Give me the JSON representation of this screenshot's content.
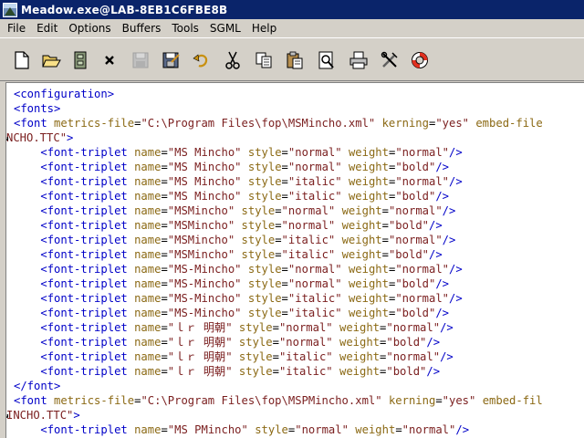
{
  "window": {
    "title": "Meadow.exe@LAB-8EB1C6FBE8B"
  },
  "menu": [
    "File",
    "Edit",
    "Options",
    "Buffers",
    "Tools",
    "SGML",
    "Help"
  ],
  "toolbar": [
    {
      "name": "new-file-icon"
    },
    {
      "name": "open-folder-icon"
    },
    {
      "name": "file-cabinet-icon"
    },
    {
      "name": "close-icon"
    },
    {
      "name": "save-disabled-icon"
    },
    {
      "name": "save-as-icon"
    },
    {
      "name": "undo-icon"
    },
    {
      "name": "cut-icon"
    },
    {
      "name": "copy-icon"
    },
    {
      "name": "paste-icon"
    },
    {
      "name": "search-icon"
    },
    {
      "name": "print-icon"
    },
    {
      "name": "tools-icon"
    },
    {
      "name": "help-lifebuoy-icon"
    }
  ],
  "editor": {
    "lines": [
      [
        {
          "t": "tag",
          "s": "<configuration>"
        }
      ],
      [
        {
          "t": "tag",
          "s": "<fonts>"
        }
      ],
      [
        {
          "t": "tag",
          "s": "<font "
        },
        {
          "t": "attr",
          "s": "metrics-file"
        },
        {
          "t": "plain",
          "s": "="
        },
        {
          "t": "val",
          "s": "\"C:\\Program Files\\fop\\MSMincho.xml\""
        },
        {
          "t": "plain",
          "s": " "
        },
        {
          "t": "attr",
          "s": "kerning"
        },
        {
          "t": "plain",
          "s": "="
        },
        {
          "t": "val",
          "s": "\"yes\""
        },
        {
          "t": "plain",
          "s": " "
        },
        {
          "t": "attr",
          "s": "embed-file"
        }
      ],
      [
        {
          "t": "cont",
          "s": "NCHO.TTC\""
        },
        {
          "t": "tag",
          "s": ">"
        }
      ],
      [
        {
          "t": "plain",
          "s": "    "
        },
        {
          "t": "tag",
          "s": "<font-triplet "
        },
        {
          "t": "attr",
          "s": "name"
        },
        {
          "t": "plain",
          "s": "="
        },
        {
          "t": "val",
          "s": "\"MS Mincho\""
        },
        {
          "t": "plain",
          "s": " "
        },
        {
          "t": "attr",
          "s": "style"
        },
        {
          "t": "plain",
          "s": "="
        },
        {
          "t": "val",
          "s": "\"normal\""
        },
        {
          "t": "plain",
          "s": " "
        },
        {
          "t": "attr",
          "s": "weight"
        },
        {
          "t": "plain",
          "s": "="
        },
        {
          "t": "val",
          "s": "\"normal\""
        },
        {
          "t": "tag",
          "s": "/>"
        }
      ],
      [
        {
          "t": "plain",
          "s": "    "
        },
        {
          "t": "tag",
          "s": "<font-triplet "
        },
        {
          "t": "attr",
          "s": "name"
        },
        {
          "t": "plain",
          "s": "="
        },
        {
          "t": "val",
          "s": "\"MS Mincho\""
        },
        {
          "t": "plain",
          "s": " "
        },
        {
          "t": "attr",
          "s": "style"
        },
        {
          "t": "plain",
          "s": "="
        },
        {
          "t": "val",
          "s": "\"normal\""
        },
        {
          "t": "plain",
          "s": " "
        },
        {
          "t": "attr",
          "s": "weight"
        },
        {
          "t": "plain",
          "s": "="
        },
        {
          "t": "val",
          "s": "\"bold\""
        },
        {
          "t": "tag",
          "s": "/>"
        }
      ],
      [
        {
          "t": "plain",
          "s": "    "
        },
        {
          "t": "tag",
          "s": "<font-triplet "
        },
        {
          "t": "attr",
          "s": "name"
        },
        {
          "t": "plain",
          "s": "="
        },
        {
          "t": "val",
          "s": "\"MS Mincho\""
        },
        {
          "t": "plain",
          "s": " "
        },
        {
          "t": "attr",
          "s": "style"
        },
        {
          "t": "plain",
          "s": "="
        },
        {
          "t": "val",
          "s": "\"italic\""
        },
        {
          "t": "plain",
          "s": " "
        },
        {
          "t": "attr",
          "s": "weight"
        },
        {
          "t": "plain",
          "s": "="
        },
        {
          "t": "val",
          "s": "\"normal\""
        },
        {
          "t": "tag",
          "s": "/>"
        }
      ],
      [
        {
          "t": "plain",
          "s": "    "
        },
        {
          "t": "tag",
          "s": "<font-triplet "
        },
        {
          "t": "attr",
          "s": "name"
        },
        {
          "t": "plain",
          "s": "="
        },
        {
          "t": "val",
          "s": "\"MS Mincho\""
        },
        {
          "t": "plain",
          "s": " "
        },
        {
          "t": "attr",
          "s": "style"
        },
        {
          "t": "plain",
          "s": "="
        },
        {
          "t": "val",
          "s": "\"italic\""
        },
        {
          "t": "plain",
          "s": " "
        },
        {
          "t": "attr",
          "s": "weight"
        },
        {
          "t": "plain",
          "s": "="
        },
        {
          "t": "val",
          "s": "\"bold\""
        },
        {
          "t": "tag",
          "s": "/>"
        }
      ],
      [
        {
          "t": "plain",
          "s": "    "
        },
        {
          "t": "tag",
          "s": "<font-triplet "
        },
        {
          "t": "attr",
          "s": "name"
        },
        {
          "t": "plain",
          "s": "="
        },
        {
          "t": "val",
          "s": "\"MSMincho\""
        },
        {
          "t": "plain",
          "s": " "
        },
        {
          "t": "attr",
          "s": "style"
        },
        {
          "t": "plain",
          "s": "="
        },
        {
          "t": "val",
          "s": "\"normal\""
        },
        {
          "t": "plain",
          "s": " "
        },
        {
          "t": "attr",
          "s": "weight"
        },
        {
          "t": "plain",
          "s": "="
        },
        {
          "t": "val",
          "s": "\"normal\""
        },
        {
          "t": "tag",
          "s": "/>"
        }
      ],
      [
        {
          "t": "plain",
          "s": "    "
        },
        {
          "t": "tag",
          "s": "<font-triplet "
        },
        {
          "t": "attr",
          "s": "name"
        },
        {
          "t": "plain",
          "s": "="
        },
        {
          "t": "val",
          "s": "\"MSMincho\""
        },
        {
          "t": "plain",
          "s": " "
        },
        {
          "t": "attr",
          "s": "style"
        },
        {
          "t": "plain",
          "s": "="
        },
        {
          "t": "val",
          "s": "\"normal\""
        },
        {
          "t": "plain",
          "s": " "
        },
        {
          "t": "attr",
          "s": "weight"
        },
        {
          "t": "plain",
          "s": "="
        },
        {
          "t": "val",
          "s": "\"bold\""
        },
        {
          "t": "tag",
          "s": "/>"
        }
      ],
      [
        {
          "t": "plain",
          "s": "    "
        },
        {
          "t": "tag",
          "s": "<font-triplet "
        },
        {
          "t": "attr",
          "s": "name"
        },
        {
          "t": "plain",
          "s": "="
        },
        {
          "t": "val",
          "s": "\"MSMincho\""
        },
        {
          "t": "plain",
          "s": " "
        },
        {
          "t": "attr",
          "s": "style"
        },
        {
          "t": "plain",
          "s": "="
        },
        {
          "t": "val",
          "s": "\"italic\""
        },
        {
          "t": "plain",
          "s": " "
        },
        {
          "t": "attr",
          "s": "weight"
        },
        {
          "t": "plain",
          "s": "="
        },
        {
          "t": "val",
          "s": "\"normal\""
        },
        {
          "t": "tag",
          "s": "/>"
        }
      ],
      [
        {
          "t": "plain",
          "s": "    "
        },
        {
          "t": "tag",
          "s": "<font-triplet "
        },
        {
          "t": "attr",
          "s": "name"
        },
        {
          "t": "plain",
          "s": "="
        },
        {
          "t": "val",
          "s": "\"MSMincho\""
        },
        {
          "t": "plain",
          "s": " "
        },
        {
          "t": "attr",
          "s": "style"
        },
        {
          "t": "plain",
          "s": "="
        },
        {
          "t": "val",
          "s": "\"italic\""
        },
        {
          "t": "plain",
          "s": " "
        },
        {
          "t": "attr",
          "s": "weight"
        },
        {
          "t": "plain",
          "s": "="
        },
        {
          "t": "val",
          "s": "\"bold\""
        },
        {
          "t": "tag",
          "s": "/>"
        }
      ],
      [
        {
          "t": "plain",
          "s": "    "
        },
        {
          "t": "tag",
          "s": "<font-triplet "
        },
        {
          "t": "attr",
          "s": "name"
        },
        {
          "t": "plain",
          "s": "="
        },
        {
          "t": "val",
          "s": "\"MS-Mincho\""
        },
        {
          "t": "plain",
          "s": " "
        },
        {
          "t": "attr",
          "s": "style"
        },
        {
          "t": "plain",
          "s": "="
        },
        {
          "t": "val",
          "s": "\"normal\""
        },
        {
          "t": "plain",
          "s": " "
        },
        {
          "t": "attr",
          "s": "weight"
        },
        {
          "t": "plain",
          "s": "="
        },
        {
          "t": "val",
          "s": "\"normal\""
        },
        {
          "t": "tag",
          "s": "/>"
        }
      ],
      [
        {
          "t": "plain",
          "s": "    "
        },
        {
          "t": "tag",
          "s": "<font-triplet "
        },
        {
          "t": "attr",
          "s": "name"
        },
        {
          "t": "plain",
          "s": "="
        },
        {
          "t": "val",
          "s": "\"MS-Mincho\""
        },
        {
          "t": "plain",
          "s": " "
        },
        {
          "t": "attr",
          "s": "style"
        },
        {
          "t": "plain",
          "s": "="
        },
        {
          "t": "val",
          "s": "\"normal\""
        },
        {
          "t": "plain",
          "s": " "
        },
        {
          "t": "attr",
          "s": "weight"
        },
        {
          "t": "plain",
          "s": "="
        },
        {
          "t": "val",
          "s": "\"bold\""
        },
        {
          "t": "tag",
          "s": "/>"
        }
      ],
      [
        {
          "t": "plain",
          "s": "    "
        },
        {
          "t": "tag",
          "s": "<font-triplet "
        },
        {
          "t": "attr",
          "s": "name"
        },
        {
          "t": "plain",
          "s": "="
        },
        {
          "t": "val",
          "s": "\"MS-Mincho\""
        },
        {
          "t": "plain",
          "s": " "
        },
        {
          "t": "attr",
          "s": "style"
        },
        {
          "t": "plain",
          "s": "="
        },
        {
          "t": "val",
          "s": "\"italic\""
        },
        {
          "t": "plain",
          "s": " "
        },
        {
          "t": "attr",
          "s": "weight"
        },
        {
          "t": "plain",
          "s": "="
        },
        {
          "t": "val",
          "s": "\"normal\""
        },
        {
          "t": "tag",
          "s": "/>"
        }
      ],
      [
        {
          "t": "plain",
          "s": "    "
        },
        {
          "t": "tag",
          "s": "<font-triplet "
        },
        {
          "t": "attr",
          "s": "name"
        },
        {
          "t": "plain",
          "s": "="
        },
        {
          "t": "val",
          "s": "\"MS-Mincho\""
        },
        {
          "t": "plain",
          "s": " "
        },
        {
          "t": "attr",
          "s": "style"
        },
        {
          "t": "plain",
          "s": "="
        },
        {
          "t": "val",
          "s": "\"italic\""
        },
        {
          "t": "plain",
          "s": " "
        },
        {
          "t": "attr",
          "s": "weight"
        },
        {
          "t": "plain",
          "s": "="
        },
        {
          "t": "val",
          "s": "\"bold\""
        },
        {
          "t": "tag",
          "s": "/>"
        }
      ],
      [
        {
          "t": "plain",
          "s": "    "
        },
        {
          "t": "tag",
          "s": "<font-triplet "
        },
        {
          "t": "attr",
          "s": "name"
        },
        {
          "t": "plain",
          "s": "="
        },
        {
          "t": "val",
          "s": "\"ｌｒ 明朝\""
        },
        {
          "t": "plain",
          "s": " "
        },
        {
          "t": "attr",
          "s": "style"
        },
        {
          "t": "plain",
          "s": "="
        },
        {
          "t": "val",
          "s": "\"normal\""
        },
        {
          "t": "plain",
          "s": " "
        },
        {
          "t": "attr",
          "s": "weight"
        },
        {
          "t": "plain",
          "s": "="
        },
        {
          "t": "val",
          "s": "\"normal\""
        },
        {
          "t": "tag",
          "s": "/>"
        }
      ],
      [
        {
          "t": "plain",
          "s": "    "
        },
        {
          "t": "tag",
          "s": "<font-triplet "
        },
        {
          "t": "attr",
          "s": "name"
        },
        {
          "t": "plain",
          "s": "="
        },
        {
          "t": "val",
          "s": "\"ｌｒ 明朝\""
        },
        {
          "t": "plain",
          "s": " "
        },
        {
          "t": "attr",
          "s": "style"
        },
        {
          "t": "plain",
          "s": "="
        },
        {
          "t": "val",
          "s": "\"normal\""
        },
        {
          "t": "plain",
          "s": " "
        },
        {
          "t": "attr",
          "s": "weight"
        },
        {
          "t": "plain",
          "s": "="
        },
        {
          "t": "val",
          "s": "\"bold\""
        },
        {
          "t": "tag",
          "s": "/>"
        }
      ],
      [
        {
          "t": "plain",
          "s": "    "
        },
        {
          "t": "tag",
          "s": "<font-triplet "
        },
        {
          "t": "attr",
          "s": "name"
        },
        {
          "t": "plain",
          "s": "="
        },
        {
          "t": "val",
          "s": "\"ｌｒ 明朝\""
        },
        {
          "t": "plain",
          "s": " "
        },
        {
          "t": "attr",
          "s": "style"
        },
        {
          "t": "plain",
          "s": "="
        },
        {
          "t": "val",
          "s": "\"italic\""
        },
        {
          "t": "plain",
          "s": " "
        },
        {
          "t": "attr",
          "s": "weight"
        },
        {
          "t": "plain",
          "s": "="
        },
        {
          "t": "val",
          "s": "\"normal\""
        },
        {
          "t": "tag",
          "s": "/>"
        }
      ],
      [
        {
          "t": "plain",
          "s": "    "
        },
        {
          "t": "tag",
          "s": "<font-triplet "
        },
        {
          "t": "attr",
          "s": "name"
        },
        {
          "t": "plain",
          "s": "="
        },
        {
          "t": "val",
          "s": "\"ｌｒ 明朝\""
        },
        {
          "t": "plain",
          "s": " "
        },
        {
          "t": "attr",
          "s": "style"
        },
        {
          "t": "plain",
          "s": "="
        },
        {
          "t": "val",
          "s": "\"italic\""
        },
        {
          "t": "plain",
          "s": " "
        },
        {
          "t": "attr",
          "s": "weight"
        },
        {
          "t": "plain",
          "s": "="
        },
        {
          "t": "val",
          "s": "\"bold\""
        },
        {
          "t": "tag",
          "s": "/>"
        }
      ],
      [
        {
          "t": "tag",
          "s": "</font>"
        }
      ],
      [
        {
          "t": "tag",
          "s": "<font "
        },
        {
          "t": "attr",
          "s": "metrics-file"
        },
        {
          "t": "plain",
          "s": "="
        },
        {
          "t": "val",
          "s": "\"C:\\Program Files\\fop\\MSPMincho.xml\""
        },
        {
          "t": "plain",
          "s": " "
        },
        {
          "t": "attr",
          "s": "kerning"
        },
        {
          "t": "plain",
          "s": "="
        },
        {
          "t": "val",
          "s": "\"yes\""
        },
        {
          "t": "plain",
          "s": " "
        },
        {
          "t": "attr",
          "s": "embed-fil"
        }
      ],
      [
        {
          "t": "cont",
          "s": "INCHO.TTC\""
        },
        {
          "t": "tag",
          "s": ">"
        }
      ],
      [
        {
          "t": "plain",
          "s": "    "
        },
        {
          "t": "tag",
          "s": "<font-triplet "
        },
        {
          "t": "attr",
          "s": "name"
        },
        {
          "t": "plain",
          "s": "="
        },
        {
          "t": "val",
          "s": "\"MS PMincho\""
        },
        {
          "t": "plain",
          "s": " "
        },
        {
          "t": "attr",
          "s": "style"
        },
        {
          "t": "plain",
          "s": "="
        },
        {
          "t": "val",
          "s": "\"normal\""
        },
        {
          "t": "plain",
          "s": " "
        },
        {
          "t": "attr",
          "s": "weight"
        },
        {
          "t": "plain",
          "s": "="
        },
        {
          "t": "val",
          "s": "\"normal\""
        },
        {
          "t": "tag",
          "s": "/>"
        }
      ]
    ],
    "continuation_rows": [
      3,
      22
    ]
  }
}
